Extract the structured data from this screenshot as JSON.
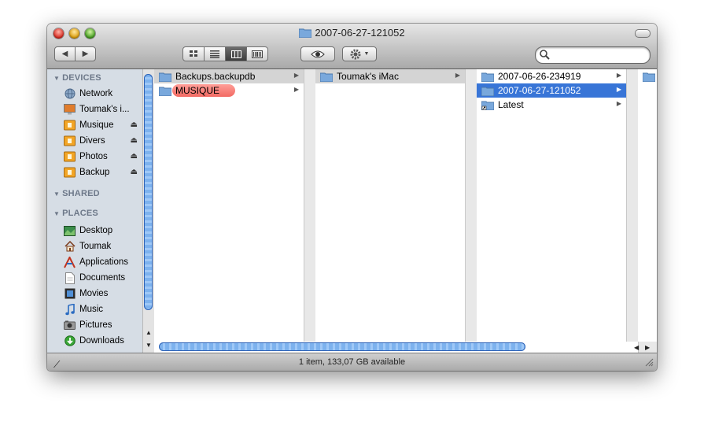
{
  "window": {
    "title": "2007-06-27-121052"
  },
  "toolbar": {
    "back_icon": "back-arrow-icon",
    "forward_icon": "forward-arrow-icon",
    "view_buttons": [
      "icon-view",
      "list-view",
      "column-view",
      "coverflow-view"
    ],
    "search_placeholder": ""
  },
  "sidebar": {
    "sections": [
      {
        "title": "DEVICES",
        "items": [
          {
            "label": "Network",
            "icon": "network-globe-icon",
            "eject": false
          },
          {
            "label": "Toumak's i...",
            "icon": "imac-icon",
            "eject": false
          },
          {
            "label": "Musique",
            "icon": "disk-icon",
            "eject": true
          },
          {
            "label": "Divers",
            "icon": "disk-icon",
            "eject": true
          },
          {
            "label": "Photos",
            "icon": "disk-icon",
            "eject": true
          },
          {
            "label": "Backup",
            "icon": "disk-icon",
            "eject": true
          }
        ]
      },
      {
        "title": "SHARED",
        "items": []
      },
      {
        "title": "PLACES",
        "items": [
          {
            "label": "Desktop",
            "icon": "desktop-icon"
          },
          {
            "label": "Toumak",
            "icon": "home-icon"
          },
          {
            "label": "Applications",
            "icon": "applications-icon"
          },
          {
            "label": "Documents",
            "icon": "documents-icon"
          },
          {
            "label": "Movies",
            "icon": "movies-icon"
          },
          {
            "label": "Music",
            "icon": "music-icon"
          },
          {
            "label": "Pictures",
            "icon": "pictures-icon"
          },
          {
            "label": "Downloads",
            "icon": "downloads-icon"
          }
        ]
      }
    ]
  },
  "columns": [
    {
      "items": [
        {
          "label": "Backups.backupdb",
          "state": "gray"
        },
        {
          "label": "MUSIQUE",
          "state": "red-label"
        }
      ]
    },
    {
      "items": [
        {
          "label": "Toumak's iMac",
          "state": "gray"
        }
      ]
    },
    {
      "items": [
        {
          "label": "2007-06-26-234919",
          "state": "normal"
        },
        {
          "label": "2007-06-27-121052",
          "state": "selected"
        },
        {
          "label": "Latest",
          "state": "alias"
        }
      ]
    }
  ],
  "status": {
    "text": "1 item, 133,07 GB available"
  },
  "colors": {
    "selection": "#3875d7",
    "red_label": "#f26a63",
    "sidebar_bg": "#d6dde5"
  }
}
